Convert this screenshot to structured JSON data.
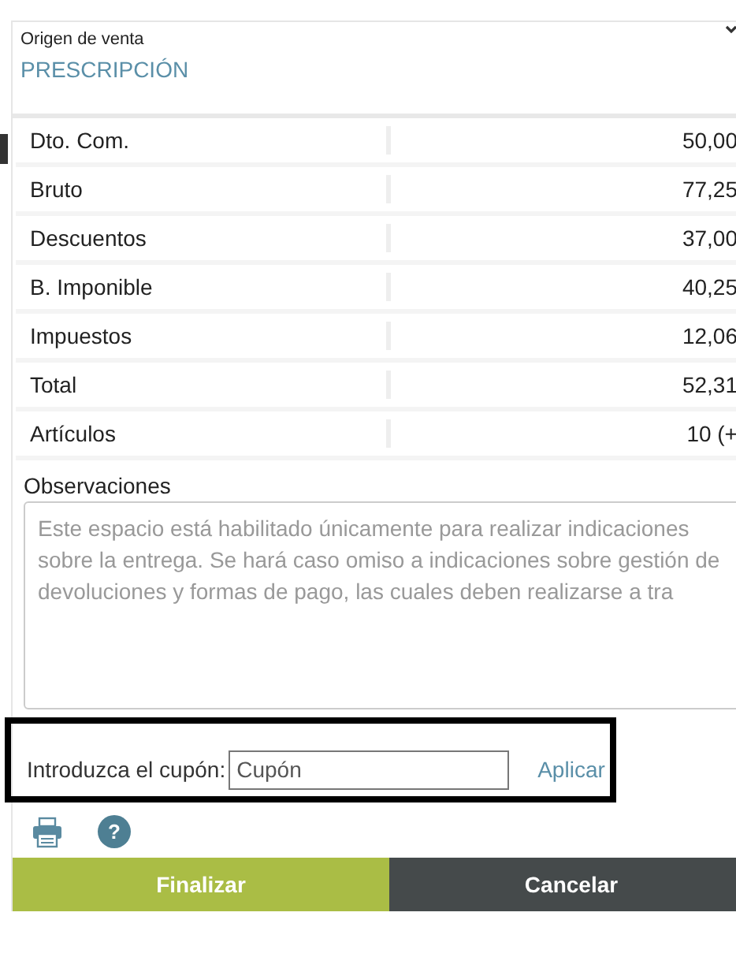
{
  "origin": {
    "label": "Origen de venta",
    "value": "PRESCRIPCIÓN"
  },
  "summary": [
    {
      "label": "Dto. Com.",
      "value": "50,00"
    },
    {
      "label": "Bruto",
      "value": "77,25"
    },
    {
      "label": "Descuentos",
      "value": "37,00"
    },
    {
      "label": "B. Imponible",
      "value": "40,25"
    },
    {
      "label": "Impuestos",
      "value": "12,06"
    },
    {
      "label": "Total",
      "value": "52,31"
    },
    {
      "label": "Artículos",
      "value": "10 (+"
    }
  ],
  "observations": {
    "label": "Observaciones",
    "placeholder": "Este espacio está habilitado únicamente para realizar indicaciones sobre la entrega. Se hará caso omiso a indicaciones sobre gestión de devoluciones y formas de pago, las cuales deben realizarse a tra"
  },
  "coupon": {
    "label": "Introduzca el cupón:",
    "placeholder": "Cupón",
    "apply": "Aplicar"
  },
  "help_icon": "?",
  "buttons": [
    {
      "label": "Finalizar",
      "kind": "primary"
    },
    {
      "label": "Cancelar",
      "kind": "secondary"
    }
  ]
}
